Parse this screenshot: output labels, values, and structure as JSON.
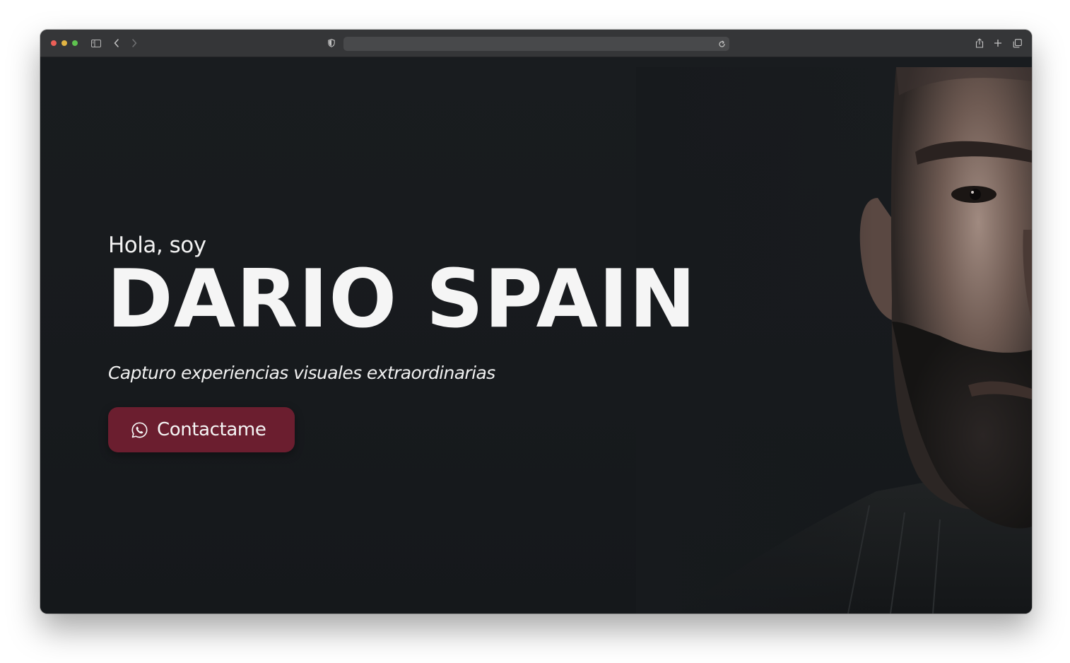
{
  "browser": {
    "address_value": "",
    "accent_colors": {
      "close": "#ec5f57",
      "minimize": "#e1b443",
      "zoom": "#5ec24f"
    },
    "icons": [
      "sidebar-icon",
      "back-icon",
      "forward-icon",
      "shield-icon",
      "reload-icon",
      "share-icon",
      "new-tab-icon",
      "tabs-overview-icon"
    ]
  },
  "hero": {
    "greeting": "Hola, soy",
    "name": "DARIO SPAIN",
    "tagline": "Capturo experiencias visuales extraordinarias",
    "cta_label": "Contactame",
    "cta_icon": "whatsapp-icon",
    "cta_color": "#6b1e2f",
    "background_color": "#171a1d"
  }
}
